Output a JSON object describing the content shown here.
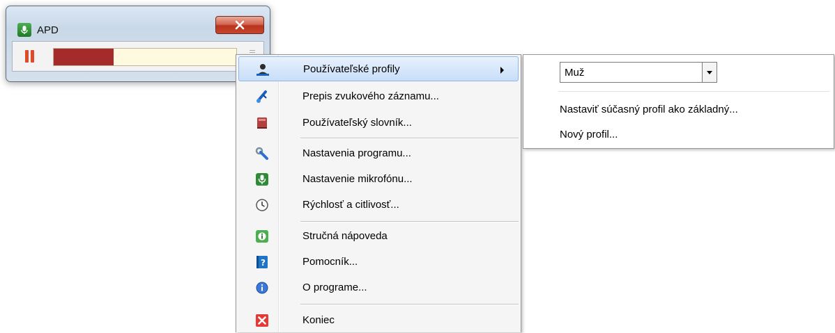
{
  "window": {
    "title": "APD",
    "level_fraction": 0.33
  },
  "context_menu": {
    "items": [
      {
        "label": "Používateľské profily",
        "icon": "user-profiles-icon",
        "submenu": true,
        "highlighted": true
      },
      {
        "label": "Prepis zvukového záznamu...",
        "icon": "transcribe-audio-icon"
      },
      {
        "label": "Používateľský slovník...",
        "icon": "dictionary-icon"
      },
      {
        "label": "Nastavenia programu...",
        "icon": "wrench-icon"
      },
      {
        "label": "Nastavenie mikrofónu...",
        "icon": "microphone-icon"
      },
      {
        "label": "Rýchlosť a citlivosť...",
        "icon": "clock-icon"
      },
      {
        "label": "Stručná nápoveda",
        "icon": "quick-help-icon"
      },
      {
        "label": "Pomocník...",
        "icon": "help-book-icon"
      },
      {
        "label": "O programe...",
        "icon": "info-icon"
      },
      {
        "label": "Koniec",
        "icon": "exit-icon"
      }
    ]
  },
  "submenu": {
    "profile_select_value": "Muž",
    "items": [
      {
        "label": "Nastaviť súčasný profil  ako základný..."
      },
      {
        "label": "Nový profil..."
      }
    ]
  },
  "colors": {
    "highlight_border": "#8eb8ec",
    "meter_fill": "#a52a2a",
    "pause": "#e04a2a",
    "close_button": "#c7452c"
  }
}
